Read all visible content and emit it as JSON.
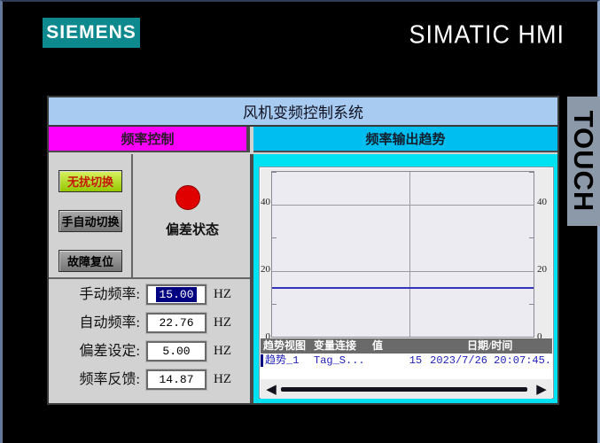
{
  "header": {
    "logo_text": "SIEMENS",
    "product_name": "SIMATIC HMI",
    "touch_label": "TOUCH"
  },
  "panel": {
    "title": "风机变频控制系统",
    "left": {
      "header": "频率控制",
      "buttons": [
        {
          "label": "无扰切换",
          "active": true
        },
        {
          "label": "手自动切换",
          "active": false
        },
        {
          "label": "故障复位",
          "active": false
        }
      ],
      "indicator": {
        "label": "偏差状态",
        "state_color": "#E00000"
      },
      "fields": [
        {
          "label": "手动频率:",
          "value": "15.00",
          "unit": "HZ",
          "selected": true
        },
        {
          "label": "自动频率:",
          "value": "22.76",
          "unit": "HZ",
          "selected": false
        },
        {
          "label": "偏差设定:",
          "value": "5.00",
          "unit": "HZ",
          "selected": false
        },
        {
          "label": "频率反馈:",
          "value": "14.87",
          "unit": "HZ",
          "selected": false
        }
      ]
    },
    "right": {
      "header": "频率输出趋势",
      "chart_data": {
        "type": "line",
        "title": "频率输出趋势",
        "ylim": [
          0,
          50
        ],
        "yticks": [
          40,
          20,
          0
        ],
        "yticks_minor": [
          50,
          30,
          10
        ],
        "grid": true,
        "legend_position": "none",
        "series": [
          {
            "name": "Tag_S...",
            "values": [
              15,
              15
            ],
            "color": "#3333BB",
            "note": "flat horizontal trend at ~15 Hz"
          }
        ]
      },
      "table": {
        "headers": [
          "趋势视图",
          "变量连接",
          "值",
          "日期/时间"
        ],
        "rows": [
          {
            "trend": "趋势_1",
            "tag": "Tag_S...",
            "value": "15",
            "datetime": "2023/7/26 20:07:45."
          }
        ]
      },
      "scrollbar": {
        "left_arrow": "◀",
        "right_arrow": "▶"
      }
    }
  },
  "colors": {
    "logo_bg": "#0E8A8E",
    "title_bar": "#A7CBF1",
    "left_header": "#FF00FF",
    "right_header": "#00BEEF",
    "trend_panel_bg": "#00E2F2",
    "active_button": "#A6D800",
    "indicator": "#E00000",
    "trend_line": "#3333BB",
    "selection": "#000080"
  }
}
